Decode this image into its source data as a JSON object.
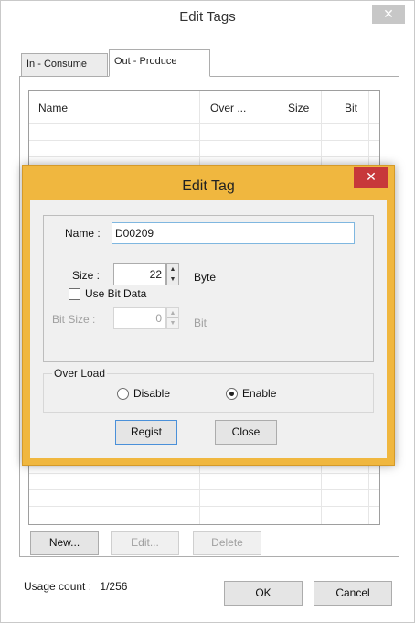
{
  "window": {
    "title": "Edit Tags",
    "close_glyph": "✕"
  },
  "tabs": [
    {
      "label": "In - Consume",
      "selected": false
    },
    {
      "label": "Out - Produce",
      "selected": true
    }
  ],
  "table": {
    "columns": [
      "Name",
      "Over ...",
      "Size",
      "Bit"
    ],
    "rows": []
  },
  "buttons": {
    "new": "New...",
    "edit": "Edit...",
    "delete": "Delete",
    "ok": "OK",
    "cancel": "Cancel"
  },
  "usage": {
    "label": "Usage count :",
    "value": "1/256"
  },
  "dialog": {
    "title": "Edit Tag",
    "close_glyph": "✕",
    "name_label": "Name :",
    "name_value": "D00209",
    "size_label": "Size :",
    "size_value": "22",
    "size_unit": "Byte",
    "use_bit_label": "Use Bit Data",
    "use_bit_checked": false,
    "bit_size_label": "Bit Size :",
    "bit_size_value": "0",
    "bit_unit": "Bit",
    "overload_legend": "Over Load",
    "overload_options": [
      {
        "label": "Disable",
        "selected": false
      },
      {
        "label": "Enable",
        "selected": true
      }
    ],
    "regist_label": "Regist",
    "close_label": "Close"
  },
  "colors": {
    "dialog_frame": "#f0b73f",
    "close_red": "#c7383a",
    "focus_border": "#7fb7e0"
  },
  "icons": {
    "spin_up": "▲",
    "spin_down": "▼"
  }
}
